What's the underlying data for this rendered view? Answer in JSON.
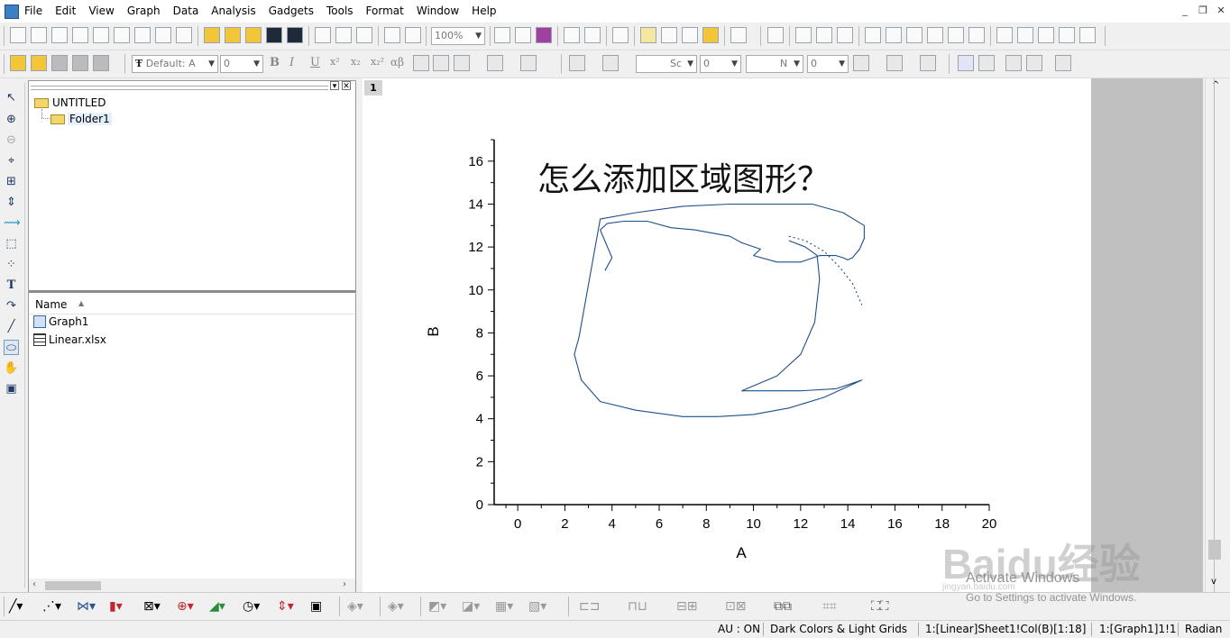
{
  "menu": {
    "items": [
      "File",
      "Edit",
      "View",
      "Graph",
      "Data",
      "Analysis",
      "Gadgets",
      "Tools",
      "Format",
      "Window",
      "Help"
    ]
  },
  "window_controls": {
    "minimize": "_",
    "restore": "❐",
    "close": "✕"
  },
  "toolbar1": {
    "zoom_value": "100%"
  },
  "toolbar2": {
    "font_value": "Default: A",
    "font_size_value": "0",
    "line_style_value": "Sc",
    "line_width_value": "0",
    "fill_value": "N",
    "fill_pattern_value": "0",
    "bold": "B",
    "italic": "I",
    "underline": "U",
    "superscript": "x²",
    "subscript": "x₂",
    "supsub": "x₂²",
    "greek": "αβ"
  },
  "explorer": {
    "root_label": "UNTITLED",
    "folder_label": "Folder1",
    "list_header": "Name",
    "items": [
      {
        "label": "Graph1",
        "icon": "graph-icon"
      },
      {
        "label": "Linear.xlsx",
        "icon": "workbook-icon"
      }
    ]
  },
  "graph": {
    "layer_tab": "1",
    "annotation": "怎么添加区域图形？"
  },
  "chart_data": {
    "type": "line",
    "title": "",
    "xlabel": "A",
    "ylabel": "B",
    "xlim": [
      -1,
      20
    ],
    "ylim": [
      0,
      17
    ],
    "xticks": [
      0,
      2,
      4,
      6,
      8,
      10,
      12,
      14,
      16,
      18,
      20
    ],
    "yticks": [
      0,
      2,
      4,
      6,
      8,
      10,
      12,
      14,
      16
    ],
    "series": [
      {
        "color": "#1f4e8c",
        "x": [
          3.7,
          4.0,
          3.5,
          3.8,
          4.5,
          5.5,
          6.5,
          7.5,
          8.5,
          9.0,
          9.5,
          10.3,
          10.0,
          11.0,
          12.0,
          12.8,
          13.5,
          13.8,
          14.0,
          14.2,
          14.5,
          14.7,
          14.7,
          13.8,
          12.5,
          11.0,
          9.0,
          7.0,
          5.0,
          3.5,
          2.6,
          2.4,
          2.7,
          3.5,
          5.0,
          7.0,
          8.5,
          10.0,
          11.5,
          13.0,
          14.6,
          13.5,
          12.0,
          10.0,
          9.5,
          11.0,
          12.0,
          12.6,
          12.8,
          12.7,
          12.2,
          11.5
        ],
        "y": [
          10.9,
          11.5,
          12.8,
          13.1,
          13.2,
          13.2,
          12.9,
          12.8,
          12.6,
          12.5,
          12.2,
          11.9,
          11.6,
          11.3,
          11.3,
          11.6,
          11.6,
          11.5,
          11.4,
          11.5,
          11.9,
          12.4,
          13.0,
          13.6,
          14.0,
          14.0,
          14.0,
          13.9,
          13.6,
          13.3,
          7.8,
          7.0,
          5.8,
          4.8,
          4.4,
          4.1,
          4.1,
          4.2,
          4.5,
          5.0,
          5.8,
          5.4,
          5.3,
          5.3,
          5.3,
          6.0,
          7.0,
          8.5,
          10.5,
          11.6,
          12.0,
          12.3
        ]
      },
      {
        "color": "#1f4e8c",
        "x": [
          11.5,
          12.2,
          13.0,
          13.7,
          14.2,
          14.6
        ],
        "y": [
          12.5,
          12.3,
          11.8,
          11.0,
          10.3,
          9.3
        ]
      }
    ],
    "grid": false
  },
  "status": {
    "au": "AU : ON",
    "theme": "Dark Colors & Light Grids",
    "cell": "1:[Linear]Sheet1!Col(B)[1:18]",
    "graph": "1:[Graph1]1!1",
    "angle": "Radian"
  },
  "watermark": {
    "line1": "Activate Windows",
    "line2": "Go to Settings to activate Windows.",
    "brand": "Baidu经验",
    "url": "jingyan.baidu.com"
  }
}
